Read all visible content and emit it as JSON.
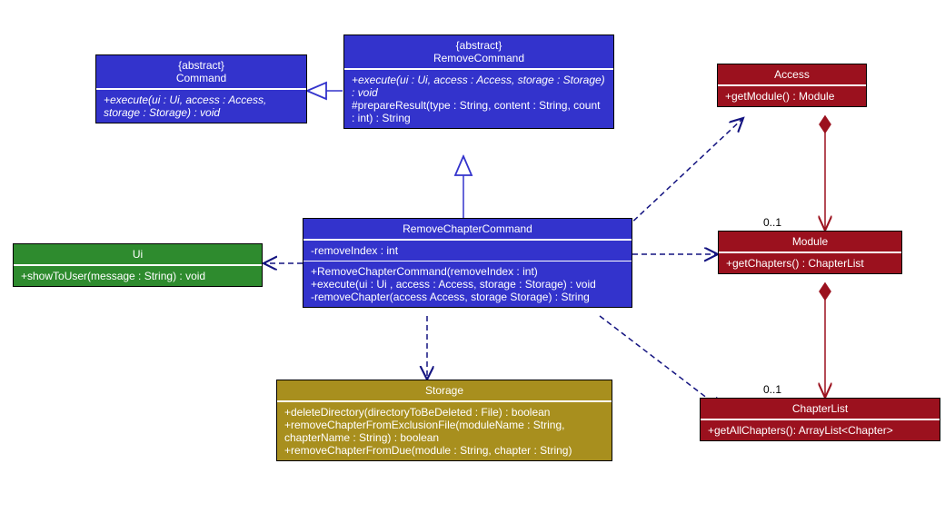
{
  "classes": {
    "command": {
      "stereotype": "{abstract}",
      "name": "Command",
      "methods": [
        "+execute(ui : Ui, access : Access, storage : Storage) : void"
      ]
    },
    "removeCommand": {
      "stereotype": "{abstract}",
      "name": "RemoveCommand",
      "methods": [
        "+execute(ui : Ui, access : Access, storage : Storage) : void",
        "#prepareResult(type : String, content : String, count : int) : String"
      ]
    },
    "removeChapterCommand": {
      "name": "RemoveChapterCommand",
      "attributes": [
        "-removeIndex : int"
      ],
      "methods": [
        "+RemoveChapterCommand(removeIndex : int)",
        "+execute(ui : Ui , access : Access, storage : Storage) : void",
        "-removeChapter(access Access, storage Storage) : String"
      ]
    },
    "ui": {
      "name": "Ui",
      "methods": [
        "+showToUser(message : String) : void"
      ]
    },
    "storage": {
      "name": "Storage",
      "methods": [
        "+deleteDirectory(directoryToBeDeleted : File) : boolean",
        "+removeChapterFromExclusionFile(moduleName : String, chapterName : String) : boolean",
        "+removeChapterFromDue(module : String, chapter : String)"
      ]
    },
    "access": {
      "name": "Access",
      "methods": [
        "+getModule() : Module"
      ]
    },
    "module": {
      "name": "Module",
      "methods": [
        "+getChapters() : ChapterList"
      ]
    },
    "chapterList": {
      "name": "ChapterList",
      "methods": [
        "+getAllChapters(): ArrayList<Chapter>"
      ]
    }
  },
  "multiplicities": {
    "accessModule": "0..1",
    "moduleChapterList": "0..1"
  }
}
